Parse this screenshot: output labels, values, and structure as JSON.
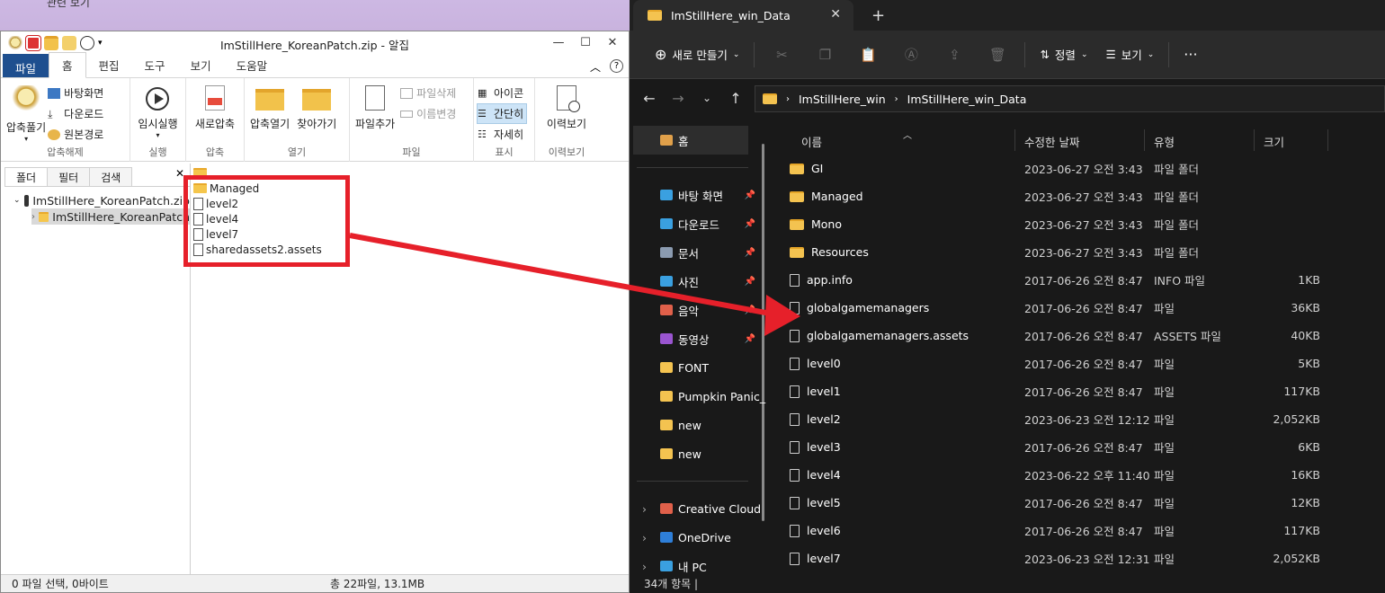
{
  "background": {
    "text": "관련 보기"
  },
  "alzip": {
    "title": "ImStillHere_KoreanPatch.zip - 알집",
    "tabs": [
      "파일",
      "홈",
      "편집",
      "도구",
      "보기",
      "도움말"
    ],
    "ribbon": {
      "extract": {
        "big": "압축풀기",
        "items": [
          "바탕화면",
          "다운로드",
          "원본경로"
        ],
        "label": "압축해제"
      },
      "run": {
        "big": "임시실행",
        "label": "실행"
      },
      "compress": {
        "big": "새로압축",
        "label": "압축"
      },
      "open": {
        "open_archive": "압축열기",
        "find": "찾아가기",
        "label": "열기"
      },
      "file": {
        "add": "파일추가",
        "delete": "파일삭제",
        "rename": "이름변경",
        "label": "파일"
      },
      "view": {
        "icons": "아이콘",
        "simple": "간단히",
        "detail": "자세히",
        "label": "표시"
      },
      "history": {
        "big": "이력보기",
        "label": "이력보기"
      }
    },
    "left_tabs": [
      "폴더",
      "필터",
      "검색"
    ],
    "tree": {
      "root": "ImStillHere_KoreanPatch.zip",
      "child": "ImStillHere_KoreanPatch"
    },
    "files": [
      {
        "name": "",
        "type": "folder"
      },
      {
        "name": "Managed",
        "type": "folder"
      },
      {
        "name": "level2",
        "type": "file"
      },
      {
        "name": "level4",
        "type": "file"
      },
      {
        "name": "level7",
        "type": "file"
      },
      {
        "name": "sharedassets2.assets",
        "type": "file"
      }
    ],
    "status_left": "0 파일 선택,  0바이트",
    "status_right": "총 22파일,  13.1MB"
  },
  "explorer": {
    "tab_title": "ImStillHere_win_Data",
    "cmd": {
      "new": "새로 만들기",
      "sort": "정렬",
      "view": "보기"
    },
    "breadcrumb": [
      "ImStillHere_win",
      "ImStillHere_win_Data"
    ],
    "nav": [
      {
        "label": "홈"
      },
      {
        "label": "바탕 화면",
        "pinned": true
      },
      {
        "label": "다운로드",
        "pinned": true
      },
      {
        "label": "문서",
        "pinned": true
      },
      {
        "label": "사진",
        "pinned": true
      },
      {
        "label": "음악",
        "pinned": true
      },
      {
        "label": "동영상",
        "pinned": true
      },
      {
        "label": "FONT"
      },
      {
        "label": "Pumpkin Panic_"
      },
      {
        "label": "new"
      },
      {
        "label": "new"
      },
      {
        "label": "Creative Cloud"
      },
      {
        "label": "OneDrive"
      },
      {
        "label": "내 PC"
      }
    ],
    "columns": [
      "이름",
      "수정한 날짜",
      "유형",
      "크기"
    ],
    "rows": [
      {
        "name": "GI",
        "date": "2023-06-27 오전 3:43",
        "type": "파일 폴더",
        "size": "",
        "folder": true
      },
      {
        "name": "Managed",
        "date": "2023-06-27 오전 3:43",
        "type": "파일 폴더",
        "size": "",
        "folder": true
      },
      {
        "name": "Mono",
        "date": "2023-06-27 오전 3:43",
        "type": "파일 폴더",
        "size": "",
        "folder": true
      },
      {
        "name": "Resources",
        "date": "2023-06-27 오전 3:43",
        "type": "파일 폴더",
        "size": "",
        "folder": true
      },
      {
        "name": "app.info",
        "date": "2017-06-26 오전 8:47",
        "type": "INFO 파일",
        "size": "1KB",
        "folder": false
      },
      {
        "name": "globalgamemanagers",
        "date": "2017-06-26 오전 8:47",
        "type": "파일",
        "size": "36KB",
        "folder": false
      },
      {
        "name": "globalgamemanagers.assets",
        "date": "2017-06-26 오전 8:47",
        "type": "ASSETS 파일",
        "size": "40KB",
        "folder": false
      },
      {
        "name": "level0",
        "date": "2017-06-26 오전 8:47",
        "type": "파일",
        "size": "5KB",
        "folder": false
      },
      {
        "name": "level1",
        "date": "2017-06-26 오전 8:47",
        "type": "파일",
        "size": "117KB",
        "folder": false
      },
      {
        "name": "level2",
        "date": "2023-06-23 오전 12:12",
        "type": "파일",
        "size": "2,052KB",
        "folder": false
      },
      {
        "name": "level3",
        "date": "2017-06-26 오전 8:47",
        "type": "파일",
        "size": "6KB",
        "folder": false
      },
      {
        "name": "level4",
        "date": "2023-06-22 오후 11:40",
        "type": "파일",
        "size": "16KB",
        "folder": false
      },
      {
        "name": "level5",
        "date": "2017-06-26 오전 8:47",
        "type": "파일",
        "size": "12KB",
        "folder": false
      },
      {
        "name": "level6",
        "date": "2017-06-26 오전 8:47",
        "type": "파일",
        "size": "117KB",
        "folder": false
      },
      {
        "name": "level7",
        "date": "2023-06-23 오전 12:31",
        "type": "파일",
        "size": "2,052KB",
        "folder": false
      }
    ],
    "status": "34개 항목  |"
  },
  "colors": {
    "annotation_red": "#e6202a",
    "alzip_file_tab": "#1e4f8f",
    "explorer_bg": "#191919"
  }
}
